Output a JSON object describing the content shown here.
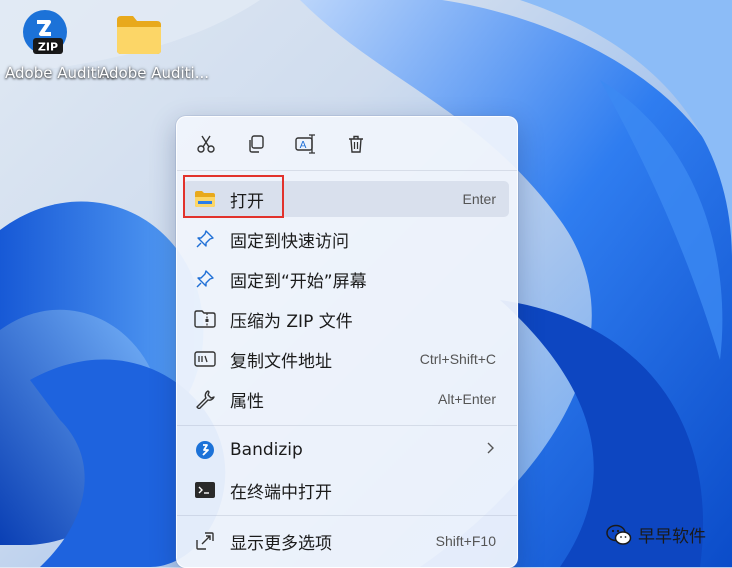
{
  "desktop": {
    "icons": [
      {
        "label": "Adobe Auditi...",
        "icon": "zip-archive-icon"
      },
      {
        "label": "Adobe Auditi...",
        "icon": "folder-icon"
      }
    ]
  },
  "context_menu": {
    "toolbar": [
      {
        "name": "cut",
        "icon": "scissors-icon"
      },
      {
        "name": "copy",
        "icon": "copy-icon"
      },
      {
        "name": "rename",
        "icon": "rename-icon"
      },
      {
        "name": "delete",
        "icon": "trash-icon"
      }
    ],
    "items": [
      {
        "label": "打开",
        "shortcut": "Enter",
        "icon": "folder-open-icon"
      },
      {
        "label": "固定到快速访问",
        "shortcut": "",
        "icon": "pin-icon"
      },
      {
        "label": "固定到“开始”屏幕",
        "shortcut": "",
        "icon": "pin-icon"
      },
      {
        "label": "压缩为 ZIP 文件",
        "shortcut": "",
        "icon": "zip-folder-icon"
      },
      {
        "label": "复制文件地址",
        "shortcut": "Ctrl+Shift+C",
        "icon": "path-copy-icon"
      },
      {
        "label": "属性",
        "shortcut": "Alt+Enter",
        "icon": "wrench-icon"
      },
      {
        "label": "Bandizip",
        "shortcut": "",
        "icon": "bandizip-icon",
        "submenu": true
      },
      {
        "label": "在终端中打开",
        "shortcut": "",
        "icon": "terminal-icon"
      },
      {
        "label": "显示更多选项",
        "shortcut": "Shift+F10",
        "icon": "more-options-icon"
      }
    ]
  },
  "watermark": {
    "text": "早早软件",
    "icon": "wechat-icon"
  },
  "colors": {
    "highlight": "#e2322c",
    "accent": "#1f6fd6"
  }
}
